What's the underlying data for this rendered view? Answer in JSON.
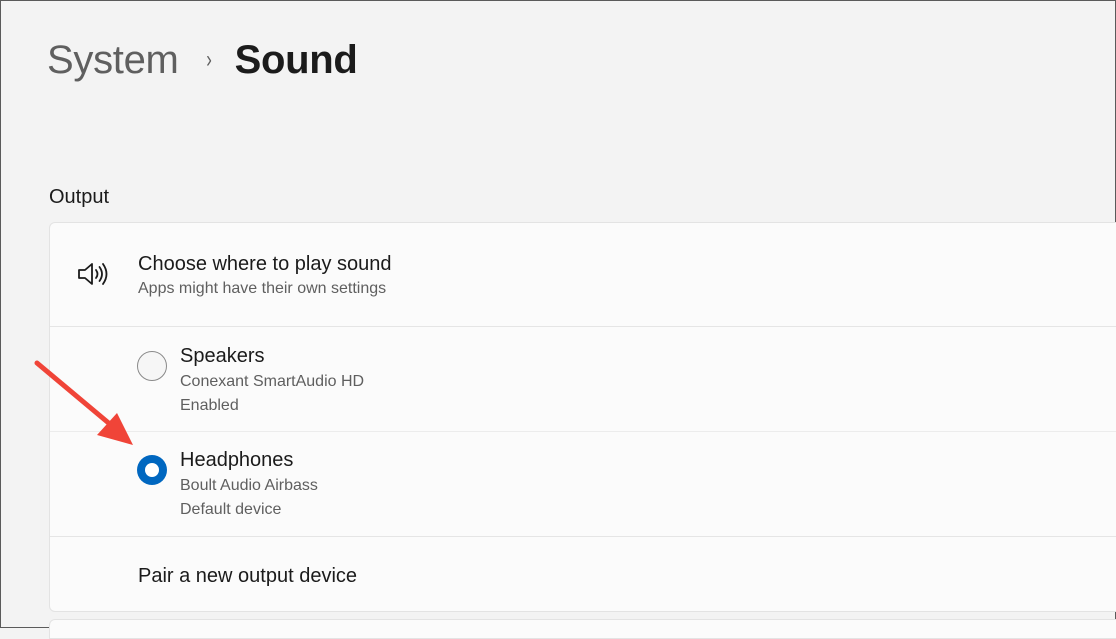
{
  "breadcrumb": {
    "parent": "System",
    "separator": "›",
    "current": "Sound"
  },
  "output": {
    "section_title": "Output",
    "header": {
      "icon": "speaker-icon",
      "title": "Choose where to play sound",
      "subtitle": "Apps might have their own settings"
    },
    "devices": [
      {
        "name": "Speakers",
        "line1": "Conexant SmartAudio HD",
        "line2": "Enabled",
        "selected": false
      },
      {
        "name": "Headphones",
        "line1": "Boult Audio Airbass",
        "line2": "Default device",
        "selected": true
      }
    ],
    "pair_label": "Pair a new output device"
  },
  "colors": {
    "accent": "#0067c0",
    "annotation_arrow": "#f04438",
    "background": "#f3f3f3",
    "card": "#fbfbfb"
  }
}
